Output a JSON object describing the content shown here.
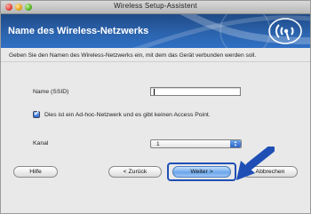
{
  "window": {
    "title": "Wireless Setup-Assistent"
  },
  "header": {
    "title": "Name des Wireless-Netzwerks",
    "logo_icon": "wireless-signal-icon"
  },
  "content": {
    "intro": "Geben Sie den Namen des Wireless-Netzwerks ein, mit dem das Gerät verbunden werden soll.",
    "ssid_label": "Name (SSID)",
    "ssid_value": "",
    "adhoc_checkbox_label": "Dies ist ein Ad-hoc-Netzwerk und es gibt keinen Access Point.",
    "adhoc_checked": true,
    "channel_label": "Kanal",
    "channel_value": "1"
  },
  "buttons": {
    "help": "Hilfe",
    "back": "< Zurück",
    "next": "Weiter >",
    "cancel": "Abbrechen"
  },
  "colors": {
    "header_blue": "#2c65b0",
    "pointer_arrow": "#1f4fb5"
  }
}
